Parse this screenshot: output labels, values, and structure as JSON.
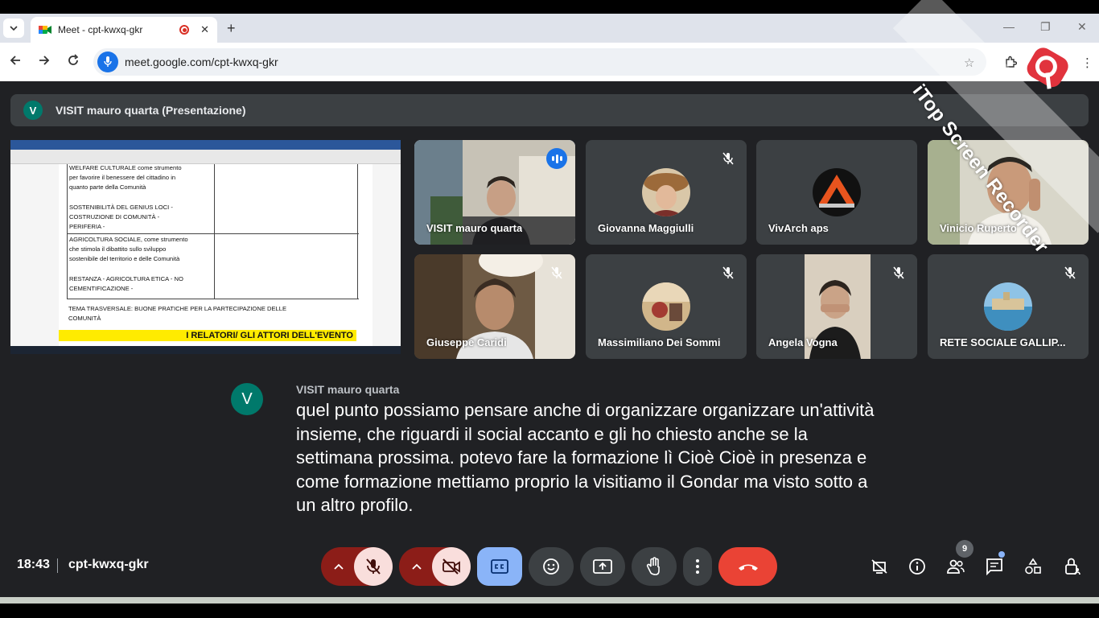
{
  "browser": {
    "tab_title": "Meet - cpt-kwxq-gkr",
    "url": "meet.google.com/cpt-kwxq-gkr",
    "new_tab": "+",
    "close_tab": "✕"
  },
  "presentation_bar": {
    "avatar_letter": "V",
    "label": "VISIT mauro quarta (Presentazione)"
  },
  "document": {
    "lines": [
      "WELFARE CULTURALE come strumento",
      "per favorire il benessere del cittadino in",
      "quanto parte della Comunità",
      "SOSTENIBILITÀ DEL GENIUS LOCI -",
      "COSTRUZIONE DI COMUNITÀ -",
      "PERIFERIA -",
      "AGRICOLTURA SOCIALE, come strumento",
      "che stimola il dibattito sullo sviluppo",
      "sostenibile del territorio e delle Comunità",
      "RESTANZA - AGRICOLTURA ETICA - NO",
      "CEMENTIFICAZIONE -",
      "TEMA TRASVERSALE: BUONE PRATICHE PER LA PARTECIPAZIONE DELLE",
      "COMUNITÀ"
    ],
    "highlight": "I RELATORI/ GLI ATTORI DELL'EVENTO"
  },
  "participants": [
    {
      "name": "VISIT mauro quarta",
      "muted": false,
      "speaking": true
    },
    {
      "name": "Giovanna Maggiulli",
      "muted": true
    },
    {
      "name": "VivArch aps",
      "muted": false
    },
    {
      "name": "Vinicio Ruperto",
      "muted": false
    },
    {
      "name": "Giuseppe Caridi",
      "muted": true
    },
    {
      "name": "Massimiliano Dei Sommi",
      "muted": true
    },
    {
      "name": "Angela Vogna",
      "muted": true
    },
    {
      "name": "RETE SOCIALE GALLIP...",
      "muted": true
    }
  ],
  "caption": {
    "avatar_letter": "V",
    "speaker": "VISIT mauro quarta",
    "text": "quel punto possiamo pensare anche di organizzare organizzare un'attività insieme, che riguardi il social accanto e gli ho chiesto anche se la settimana prossima. potevo fare la formazione lì Cioè Cioè in presenza e come formazione mettiamo proprio la visitiamo il Gondar ma visto sotto a un altro profilo."
  },
  "meeting": {
    "time": "18:43",
    "code": "cpt-kwxq-gkr",
    "participant_count": "9"
  },
  "watermark": {
    "text": "iTop Screen Recorder"
  },
  "colors": {
    "meet_bg": "#202124",
    "tile_bg": "#3c4043",
    "end_call": "#ea4335",
    "mic_off_bg": "#f9dedc",
    "captions_bg": "#8ab4f8",
    "accent": "#1a73e8"
  },
  "icons": {
    "mic": "mic-off-icon",
    "camera": "videocam-off-icon",
    "captions": "closed-caption-icon",
    "emoji": "emoji-icon",
    "present": "present-screen-icon",
    "hand": "raise-hand-icon",
    "more": "more-vert-icon",
    "end": "call-end-icon"
  }
}
